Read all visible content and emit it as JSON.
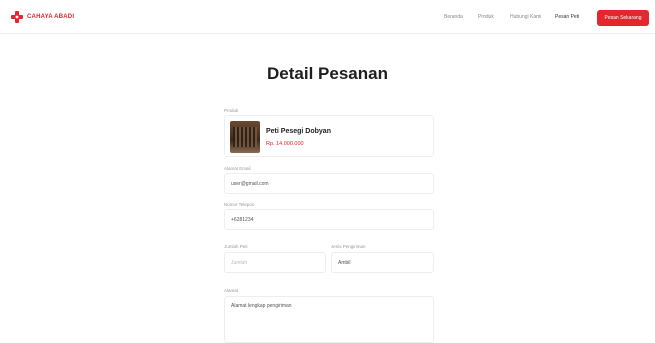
{
  "nav": {
    "brand": "CAHAYA ABADI",
    "links": [
      {
        "label": "Beranda"
      },
      {
        "label": "Produk"
      },
      {
        "label": "Hubungi Kami"
      },
      {
        "label": "Pesan Peti"
      }
    ],
    "order_button": "Pesan Sekarang"
  },
  "page": {
    "title": "Detail Pesanan"
  },
  "product": {
    "label": "Produk",
    "name": "Peti Pesegi Dobyan",
    "price": "Rp. 14.000.000"
  },
  "form": {
    "email": {
      "label": "Alamat Email",
      "value": "user@gmail.com"
    },
    "phone": {
      "label": "Nomor Telepon",
      "value": "+6281234"
    },
    "quantity": {
      "label": "Jumlah Peti",
      "placeholder": "Jumlah"
    },
    "shipping": {
      "label": "Jenis Pengiriman",
      "value": "Ambil"
    },
    "address": {
      "label": "Alamat",
      "value": "Alamat lengkap pengiriman"
    }
  },
  "colors": {
    "accent": "#e5262e",
    "border": "#eeeeee"
  }
}
